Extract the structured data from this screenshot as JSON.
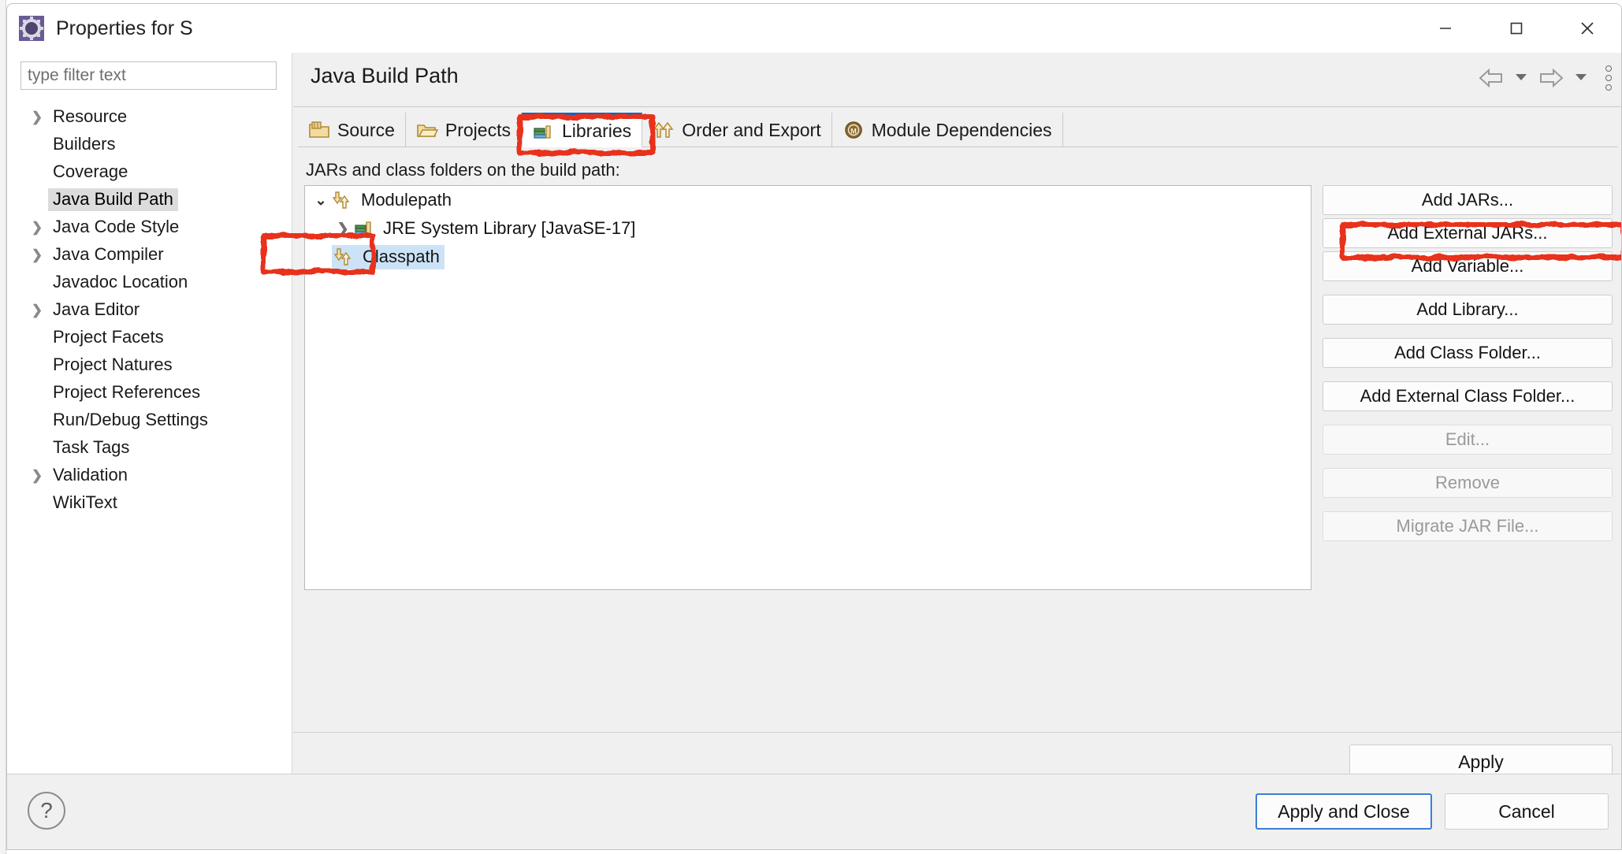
{
  "window": {
    "title": "Properties for S",
    "icon": "eclipse-properties-icon",
    "minimize_label": "–",
    "maximize_label": "□",
    "close_label": "✕"
  },
  "sidebar": {
    "filter": {
      "value": "",
      "placeholder": "type filter text"
    },
    "items": [
      {
        "label": "Resource",
        "expandable": true,
        "selected": false
      },
      {
        "label": "Builders",
        "expandable": false,
        "selected": false
      },
      {
        "label": "Coverage",
        "expandable": false,
        "selected": false
      },
      {
        "label": "Java Build Path",
        "expandable": false,
        "selected": true
      },
      {
        "label": "Java Code Style",
        "expandable": true,
        "selected": false
      },
      {
        "label": "Java Compiler",
        "expandable": true,
        "selected": false
      },
      {
        "label": "Javadoc Location",
        "expandable": false,
        "selected": false
      },
      {
        "label": "Java Editor",
        "expandable": true,
        "selected": false
      },
      {
        "label": "Project Facets",
        "expandable": false,
        "selected": false
      },
      {
        "label": "Project Natures",
        "expandable": false,
        "selected": false
      },
      {
        "label": "Project References",
        "expandable": false,
        "selected": false
      },
      {
        "label": "Run/Debug Settings",
        "expandable": false,
        "selected": false
      },
      {
        "label": "Task Tags",
        "expandable": false,
        "selected": false
      },
      {
        "label": "Validation",
        "expandable": true,
        "selected": false
      },
      {
        "label": "WikiText",
        "expandable": false,
        "selected": false
      }
    ]
  },
  "main": {
    "page_title": "Java Build Path",
    "nav": {
      "back_label": "⇦",
      "back_menu_label": "▾",
      "forward_label": "⇨",
      "forward_menu_label": "▾",
      "overflow_label": "kebab-menu"
    },
    "tabs": [
      {
        "label": "Source",
        "icon": "source-folder-icon",
        "active": false
      },
      {
        "label": "Projects",
        "icon": "projects-folder-icon",
        "active": false
      },
      {
        "label": "Libraries",
        "icon": "libraries-books-icon",
        "active": true
      },
      {
        "label": "Order and Export",
        "icon": "order-export-arrow-icon",
        "active": false
      },
      {
        "label": "Module Dependencies",
        "icon": "module-m-icon",
        "active": false
      }
    ],
    "content_label": "JARs and class folders on the build path:",
    "tree": [
      {
        "label": "Modulepath",
        "icon": "modulepath-arrows-icon",
        "twisty": "open",
        "indent": 0,
        "selected": false
      },
      {
        "label": "JRE System Library [JavaSE-17]",
        "icon": "library-books-icon",
        "twisty": "closed",
        "indent": 1,
        "selected": false
      },
      {
        "label": "Classpath",
        "icon": "classpath-arrows-icon",
        "twisty": "none",
        "indent": 0,
        "selected": true
      }
    ],
    "buttons": [
      {
        "label": "Add JARs...",
        "enabled": true,
        "gap": false
      },
      {
        "label": "Add External JARs...",
        "enabled": true,
        "gap": false
      },
      {
        "label": "Add Variable...",
        "enabled": true,
        "gap": false
      },
      {
        "label": "Add Library...",
        "enabled": true,
        "gap": true
      },
      {
        "label": "Add Class Folder...",
        "enabled": true,
        "gap": true
      },
      {
        "label": "Add External Class Folder...",
        "enabled": true,
        "gap": true
      },
      {
        "label": "Edit...",
        "enabled": false,
        "gap": true
      },
      {
        "label": "Remove",
        "enabled": false,
        "gap": true
      },
      {
        "label": "Migrate JAR File...",
        "enabled": false,
        "gap": true
      }
    ],
    "apply_label": "Apply"
  },
  "footer": {
    "help_label": "?",
    "apply_and_close_label": "Apply and Close",
    "cancel_label": "Cancel"
  },
  "annotations": [
    {
      "name": "libraries-tab-highlight"
    },
    {
      "name": "classpath-node-highlight"
    },
    {
      "name": "add-external-jars-highlight"
    }
  ],
  "colors": {
    "accent_blue": "#0a64c8",
    "selection_blue": "#cce3f7",
    "annotation_red": "#e8331c",
    "sidebar_selection_gray": "#dcdcdc"
  }
}
